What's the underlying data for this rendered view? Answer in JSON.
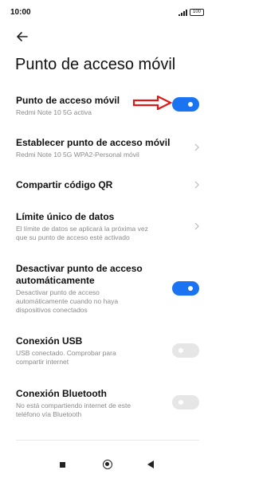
{
  "status_bar": {
    "time": "10:00",
    "battery": "100",
    "icons": [
      "signal-icon",
      "battery-icon"
    ]
  },
  "header": {
    "back_icon": "arrow-left-icon",
    "title": "Punto de acceso móvil"
  },
  "settings": [
    {
      "title": "Punto de acceso móvil",
      "subtitle": "Redmi Note 10 5G activa",
      "control": "toggle",
      "toggle_on": true
    },
    {
      "title": "Establecer punto de acceso móvil",
      "subtitle": "Redmi Note 10 5G WPA2-Personal móvil",
      "control": "chevron"
    },
    {
      "title": "Compartir código QR",
      "subtitle": "",
      "control": "chevron"
    },
    {
      "title": "Límite único de datos",
      "subtitle_lines": [
        "El límite de datos se aplicará la próxima vez",
        "que su punto de acceso esté activado"
      ],
      "control": "chevron"
    },
    {
      "title_lines": [
        "Desactivar punto de acceso",
        "automáticamente"
      ],
      "subtitle_lines": [
        "Desactivar punto de acceso",
        "automáticamente cuando no haya",
        "dispositivos conectados"
      ],
      "control": "toggle",
      "toggle_on": true
    },
    {
      "title": "Conexión USB",
      "subtitle_lines": [
        "USB conectado. Comprobar para",
        "compartir internet"
      ],
      "control": "toggle",
      "toggle_on": false
    },
    {
      "title": "Conexión Bluetooth",
      "subtitle_lines": [
        "No está compartiendo internet de este",
        "teléfono vía Bluetooth"
      ],
      "control": "toggle",
      "toggle_on": false
    }
  ],
  "annotation": {
    "type": "arrow",
    "color": "#e01818"
  },
  "colors": {
    "accent": "#1a73f0",
    "toggle_off": "#e6e6e6",
    "subtitle": "#8a8a8a"
  },
  "nav_bar": {
    "icons": [
      "recents-square-icon",
      "home-circle-icon",
      "back-triangle-icon"
    ]
  }
}
